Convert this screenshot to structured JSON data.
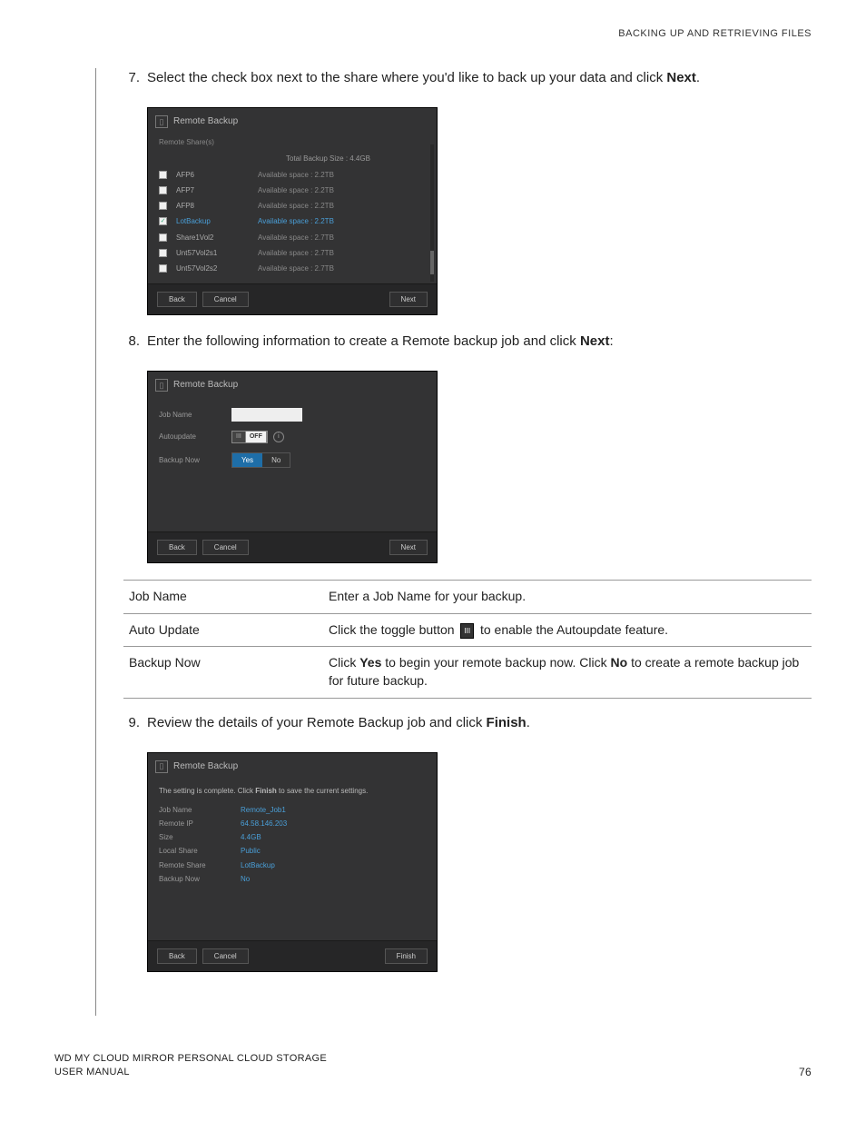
{
  "header": {
    "section_title": "BACKING UP AND RETRIEVING FILES"
  },
  "steps": {
    "s7": {
      "num": "7.",
      "text_a": "Select the check box next to the share where you'd like to back up your data and click ",
      "text_b": "Next",
      "text_c": "."
    },
    "s8": {
      "num": "8.",
      "text_a": "Enter the following information to create a Remote backup job and click ",
      "text_b": "Next",
      "text_c": ":"
    },
    "s9": {
      "num": "9.",
      "text_a": "Review the details of your Remote Backup job and click ",
      "text_b": "Finish",
      "text_c": "."
    }
  },
  "dialog1": {
    "title": "Remote Backup",
    "subtitle": "Remote Share(s)",
    "total": "Total Backup Size : 4.4GB",
    "shares": [
      {
        "name": "AFP6",
        "space": "Available space : 2.2TB",
        "checked": false
      },
      {
        "name": "AFP7",
        "space": "Available space : 2.2TB",
        "checked": false
      },
      {
        "name": "AFP8",
        "space": "Available space : 2.2TB",
        "checked": false
      },
      {
        "name": "LotBackup",
        "space": "Available space : 2.2TB",
        "checked": true,
        "selected": true
      },
      {
        "name": "Share1Vol2",
        "space": "Available space : 2.7TB",
        "checked": false
      },
      {
        "name": "Unt57Vol2s1",
        "space": "Available space : 2.7TB",
        "checked": false
      },
      {
        "name": "Unt57Vol2s2",
        "space": "Available space : 2.7TB",
        "checked": false
      }
    ],
    "back": "Back",
    "cancel": "Cancel",
    "next": "Next"
  },
  "dialog2": {
    "title": "Remote Backup",
    "job_name_label": "Job Name",
    "autoupdate_label": "Autoupdate",
    "toggle_text": "OFF",
    "backup_now_label": "Backup Now",
    "yes": "Yes",
    "no": "No",
    "back": "Back",
    "cancel": "Cancel",
    "next": "Next"
  },
  "field_table": {
    "r1": {
      "label": "Job Name",
      "desc": "Enter a Job Name for your backup."
    },
    "r2": {
      "label": "Auto Update",
      "desc_a": "Click the toggle button ",
      "toggle": "III",
      "desc_b": " to enable the Autoupdate feature."
    },
    "r3": {
      "label": "Backup Now",
      "desc_a": "Click ",
      "yes": "Yes",
      "desc_b": " to begin your remote backup now. Click ",
      "no": "No",
      "desc_c": " to create a remote backup job for future backup."
    }
  },
  "dialog3": {
    "title": "Remote Backup",
    "msg_a": "The setting is complete. Click ",
    "msg_b": "Finish",
    "msg_c": " to save the current settings.",
    "rows": {
      "job_name": {
        "label": "Job Name",
        "val": "Remote_Job1"
      },
      "remote_ip": {
        "label": "Remote IP",
        "val": "64.58.146.203"
      },
      "size": {
        "label": "Size",
        "val": "4.4GB"
      },
      "local_share": {
        "label": "Local Share",
        "val": "Public"
      },
      "remote_share": {
        "label": "Remote Share",
        "val": "LotBackup"
      },
      "backup_now": {
        "label": "Backup Now",
        "val": "No"
      }
    },
    "back": "Back",
    "cancel": "Cancel",
    "finish": "Finish"
  },
  "footer": {
    "line1": "WD MY CLOUD MIRROR PERSONAL CLOUD STORAGE",
    "line2": "USER MANUAL",
    "page": "76"
  }
}
